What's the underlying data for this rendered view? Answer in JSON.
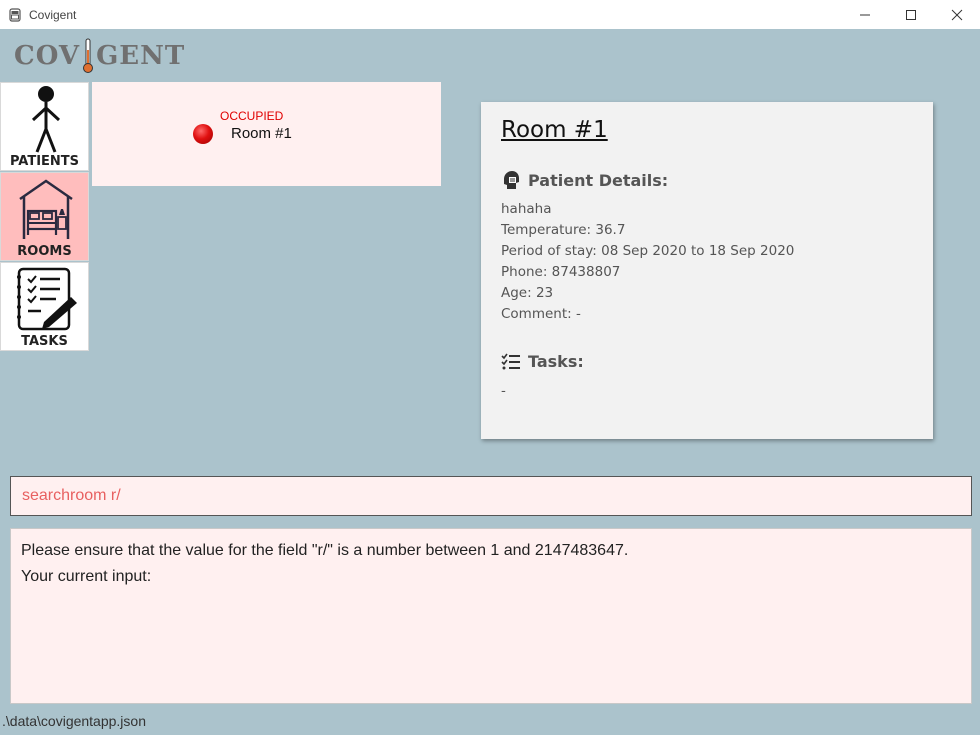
{
  "window": {
    "title": "Covigent",
    "app_icon": "bed-icon",
    "controls": [
      "minimize-icon",
      "maximize-icon",
      "close-icon"
    ]
  },
  "logo": {
    "text_left": "COV",
    "text_right": "GENT",
    "icon": "thermometer-icon"
  },
  "sidebar": {
    "items": [
      {
        "label": "PATIENTS",
        "icon": "person-icon",
        "active": false
      },
      {
        "label": "ROOMS",
        "icon": "bedroom-icon",
        "active": true
      },
      {
        "label": "TASKS",
        "icon": "checklist-icon",
        "active": false
      }
    ]
  },
  "room_list": {
    "rooms": [
      {
        "status": "OCCUPIED",
        "name": "Room #1",
        "status_color": "#e00000"
      }
    ]
  },
  "detail": {
    "title": "Room #1",
    "patient_heading": "Patient Details:",
    "patient_icon": "patient-head-icon",
    "patient_name": "hahaha",
    "temperature": "Temperature: 36.7",
    "period": "Period of stay: 08 Sep 2020 to 18 Sep 2020",
    "phone": "Phone: 87438807",
    "age": "Age: 23",
    "comment": "Comment: -",
    "tasks_heading": "Tasks:",
    "tasks_icon": "task-list-icon",
    "tasks_value": "-"
  },
  "command": {
    "value": "searchroom r/"
  },
  "result": {
    "line1": "Please ensure that the value for the field \"r/\" is a number between 1 and 2147483647.",
    "line2": "Your current input:"
  },
  "status_bar": {
    "path": ".\\data\\covigentapp.json"
  },
  "colors": {
    "background": "#abc3cc",
    "active_nav": "#ffbdbd",
    "panel_pink": "#fff0f0",
    "occupied_red": "#e00000"
  }
}
